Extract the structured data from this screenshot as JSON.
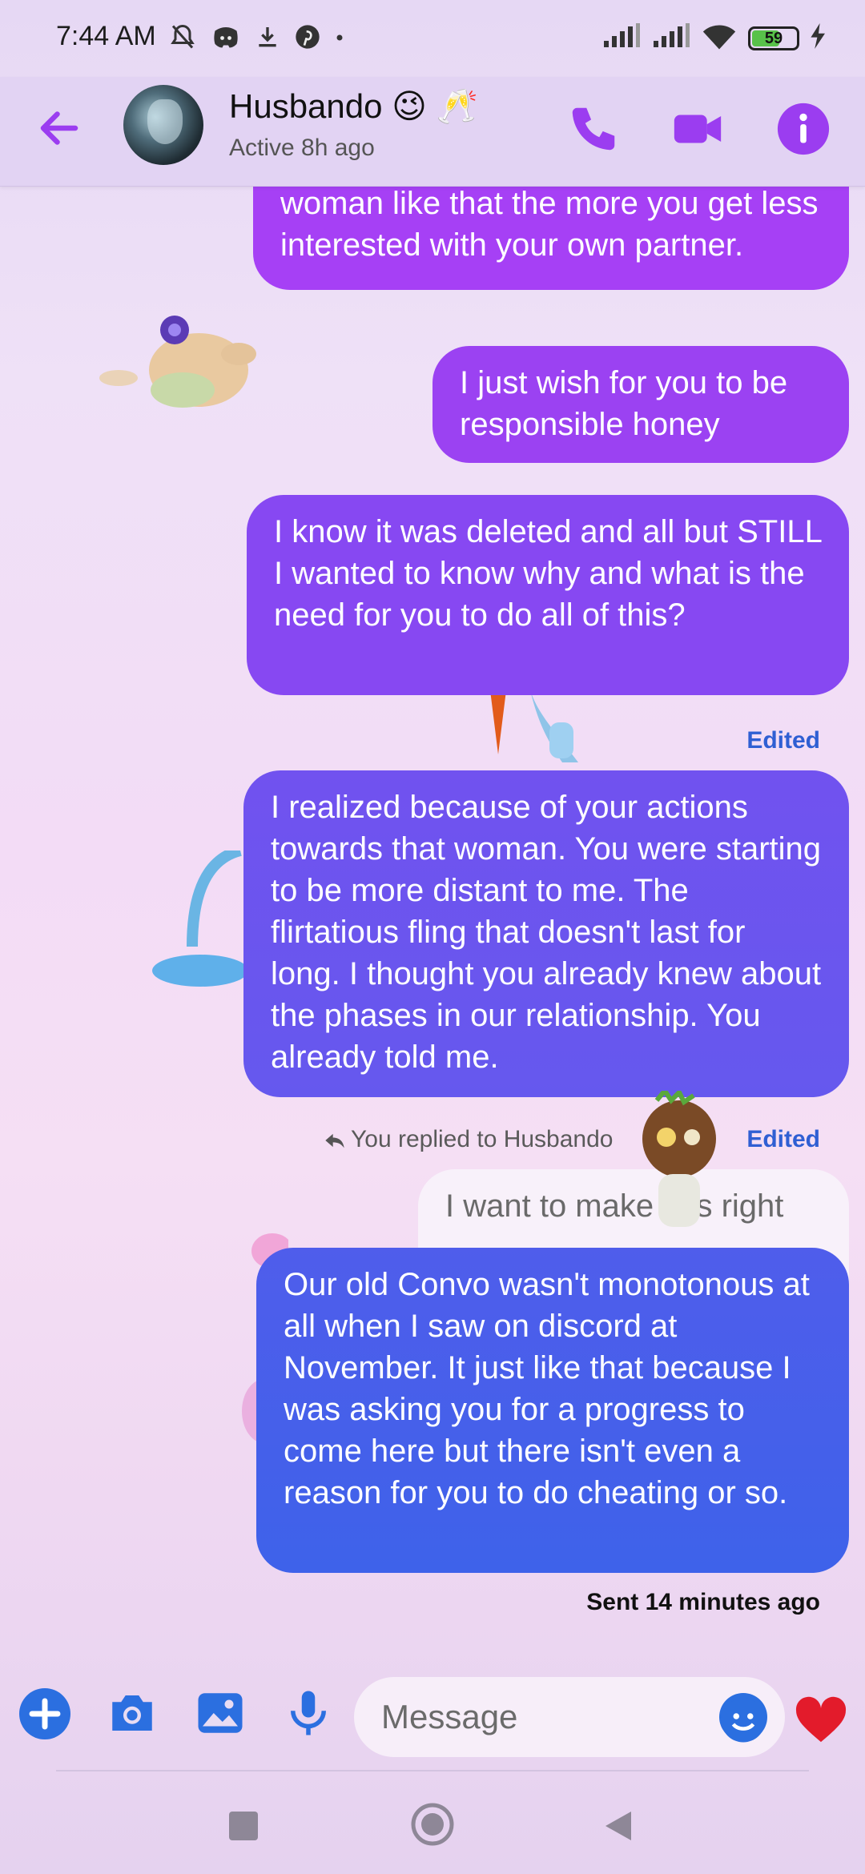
{
  "status_bar": {
    "time": "7:44 AM",
    "battery_level": "59",
    "icons": [
      "muted-notification-icon",
      "discord-icon",
      "download-icon",
      "pinterest-icon",
      "dot-icon",
      "signal-icon",
      "signal-icon",
      "wifi-icon",
      "battery-icon",
      "charging-icon"
    ]
  },
  "header": {
    "contact_name": "Husbando 😉 🥂",
    "contact_status": "Active 8h ago",
    "accent": "#9b3df0"
  },
  "messages": [
    {
      "text": "And the more you entertain other woman like that the more you get less interested with your own partner.",
      "color": "#a640f5"
    },
    {
      "text": "I just wish for you to be responsible honey",
      "color": "#9b42f2"
    },
    {
      "text": "I know it was deleted and all but STILL I wanted to know why and what is the need for you to do all of this?",
      "color": "#8748f2"
    },
    {
      "text": "I realized because of your actions towards that woman. You were starting to be more distant to me. The flirtatious fling that doesn't last for long. I thought you already knew about the phases in our relationship. You already told me.",
      "color": "#6a56ee"
    },
    {
      "text": "Our old Convo wasn't monotonous at all when I saw on discord at November. It just like that because I was asking you for a progress to come here but there isn't even a reason for you to do cheating or so.",
      "color": "#4460ea"
    }
  ],
  "edited_label": "Edited",
  "reply_indicator": "You replied to Husbando",
  "quoted_message": "I want to make this right",
  "sent_status": "Sent 14 minutes ago",
  "composer": {
    "placeholder": "Message"
  }
}
